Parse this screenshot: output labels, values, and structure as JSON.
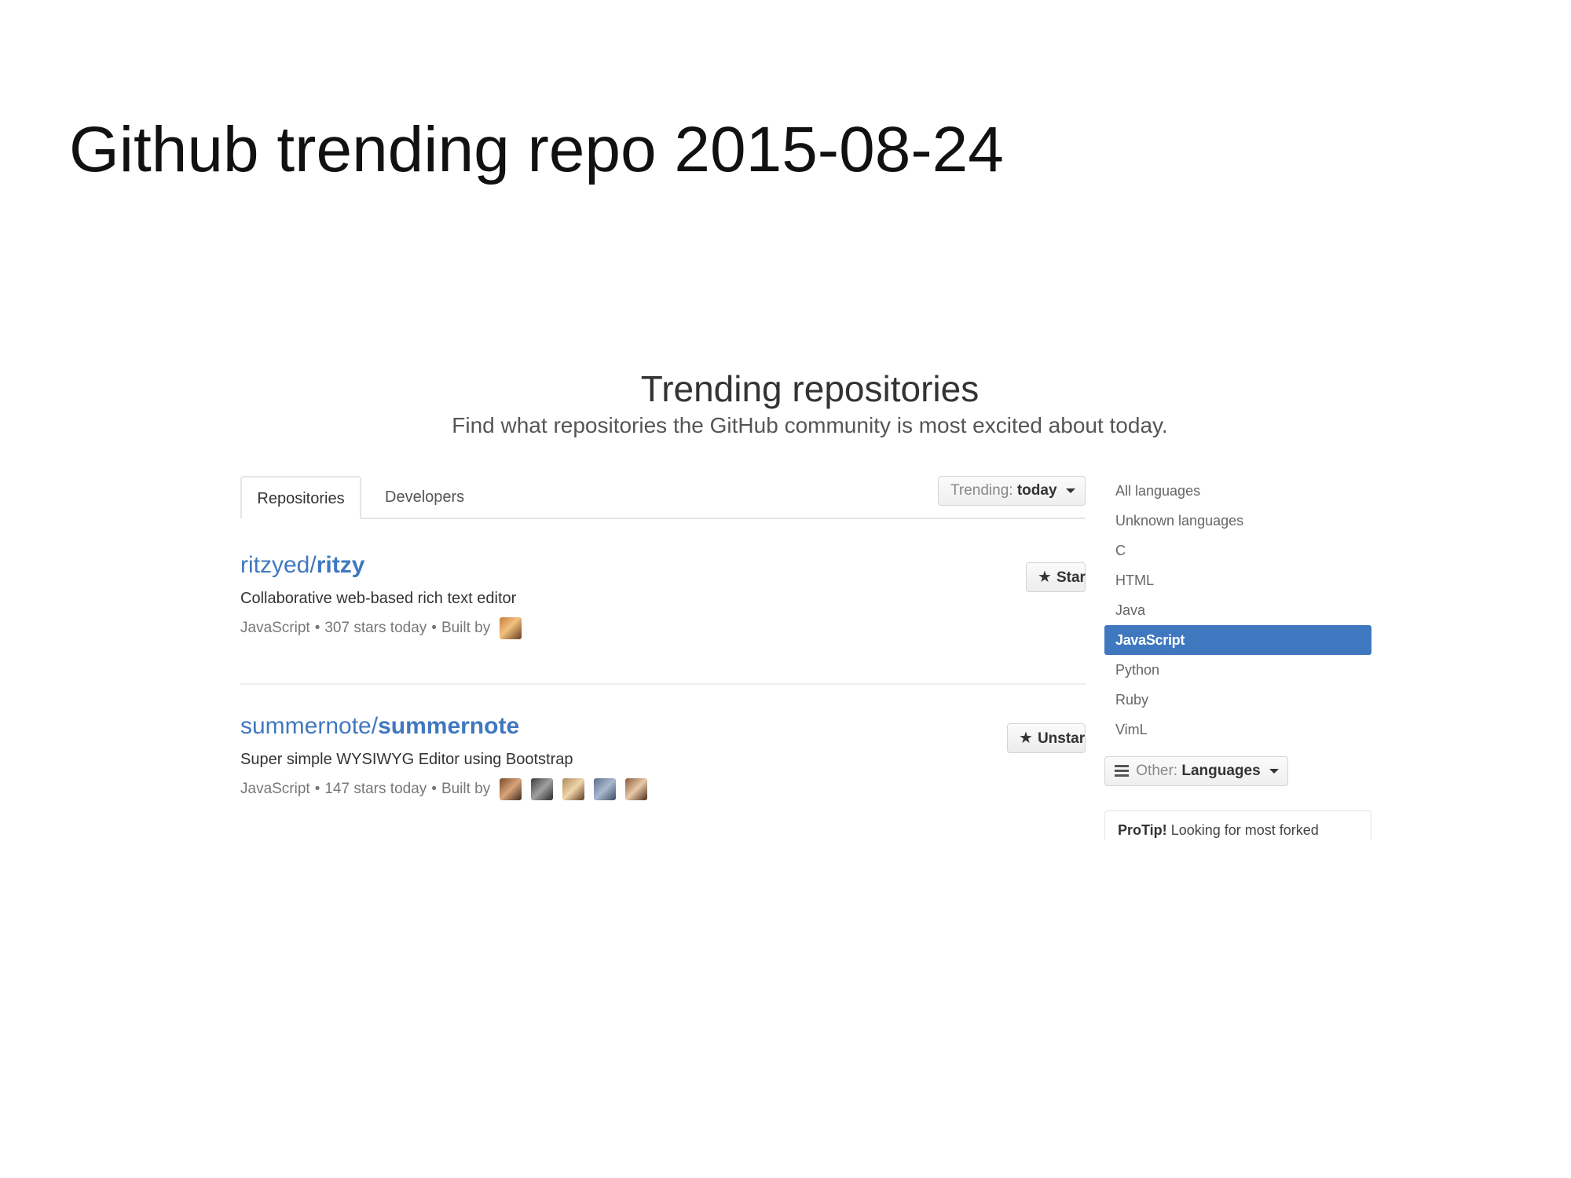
{
  "slide_title": "Github trending repo 2015-08-24",
  "header": {
    "title": "Trending repositories",
    "subtitle": "Find what repositories the GitHub community is most excited about today."
  },
  "tabs": {
    "repositories": "Repositories",
    "developers": "Developers"
  },
  "trending_filter": {
    "label": "Trending:",
    "value": "today"
  },
  "repos": [
    {
      "owner": "ritzyed",
      "separator": "/",
      "name": "ritzy",
      "description": "Collaborative web-based rich text editor",
      "language": "JavaScript",
      "stars_today": "307 stars today",
      "built_by": "Built by",
      "meta_sep": "•",
      "action": "Star"
    },
    {
      "owner": "summernote",
      "separator": "/",
      "name": "summernote",
      "description": "Super simple WYSIWYG Editor using Bootstrap",
      "language": "JavaScript",
      "stars_today": "147 stars today",
      "built_by": "Built by",
      "meta_sep": "•",
      "action": "Unstar"
    }
  ],
  "languages": [
    "All languages",
    "Unknown languages",
    "C",
    "HTML",
    "Java",
    "JavaScript",
    "Python",
    "Ruby",
    "VimL"
  ],
  "selected_language": "JavaScript",
  "other_languages": {
    "label": "Other:",
    "value": "Languages"
  },
  "protip": {
    "bold": "ProTip!",
    "text": "Looking for most forked"
  },
  "colors": {
    "link": "#4078c0",
    "selected_bg": "#4078c0"
  }
}
